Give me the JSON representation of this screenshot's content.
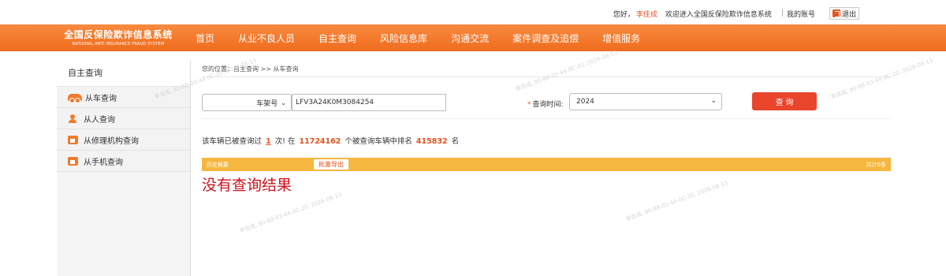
{
  "topbar": {
    "greeting": "您好，",
    "username": "李佳成",
    "welcome": "欢迎进入全国反保险欺诈信息系统",
    "separator": "|",
    "account": "我的账号",
    "logout": "退出"
  },
  "brand": {
    "title": "全国反保险欺诈信息系统",
    "subtitle": "NATIONAL ANTI INSURANCE FRAUD SYSTEM"
  },
  "nav": {
    "items": [
      "首页",
      "从业不良人员",
      "自主查询",
      "风险信息库",
      "沟通交流",
      "案件调查及追偿",
      "增值服务"
    ]
  },
  "sidebar": {
    "title": "自主查询",
    "items": [
      {
        "label": "从车查询",
        "icon": "car-icon"
      },
      {
        "label": "从人查询",
        "icon": "person-icon"
      },
      {
        "label": "从修理机构查询",
        "icon": "repair-shop-icon"
      },
      {
        "label": "从手机查询",
        "icon": "phone-icon"
      }
    ]
  },
  "breadcrumb": "您的位置：自主查询 >> 从车查询",
  "query": {
    "type_value": "车架号",
    "vin_value": "LFV3A24K0M3084254",
    "time_label": "查询时间:",
    "time_star": "*",
    "time_value": "2024",
    "submit_label": "查 询"
  },
  "stats": {
    "prefix": "该车辆已被查询过",
    "count": "1",
    "mid1": "次! 在",
    "total": "11724162",
    "mid2": "个被查询车辆中排名",
    "rank": "415832",
    "suffix": "名"
  },
  "history": {
    "title": "历史概要",
    "export_label": "批量导出",
    "total_label": "共计0条"
  },
  "no_result": "没有查询结果",
  "watermark": "李佳成, 80-88-03-44-0C-20, 2026-08-13",
  "colors": {
    "accent": "#ef6c1e",
    "button": "#e9452c",
    "history_bar": "#f5b73f",
    "no_result": "#d0121b"
  }
}
